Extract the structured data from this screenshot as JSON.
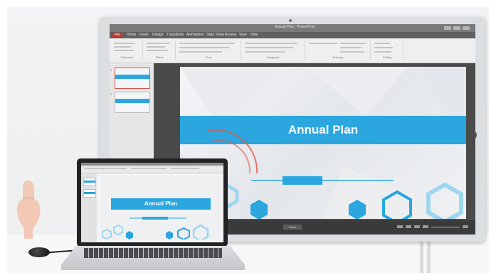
{
  "monitor": {
    "window_title": "Annual Plan - PowerPoint",
    "ribbon_tabs": [
      "File",
      "Home",
      "Insert",
      "Design",
      "Transitions",
      "Animations",
      "Slide Show",
      "Review",
      "View",
      "Help"
    ],
    "ribbon_groups": [
      "Clipboard",
      "Slides",
      "Font",
      "Paragraph",
      "Drawing",
      "Editing"
    ],
    "thumbnails": [
      {
        "num": "1",
        "selected": true
      },
      {
        "num": "2",
        "selected": false
      }
    ],
    "slide": {
      "title": "Annual Plan",
      "accent_color": "#2ba6de"
    },
    "status": {
      "center": "Notes"
    }
  },
  "laptop": {
    "slide": {
      "title": "Annual Plan"
    }
  },
  "colors": {
    "accent": "#2ba6de",
    "selection": "#d9534f",
    "hexagon_outline": "#9fd6ef",
    "signal": "#e2574c"
  }
}
